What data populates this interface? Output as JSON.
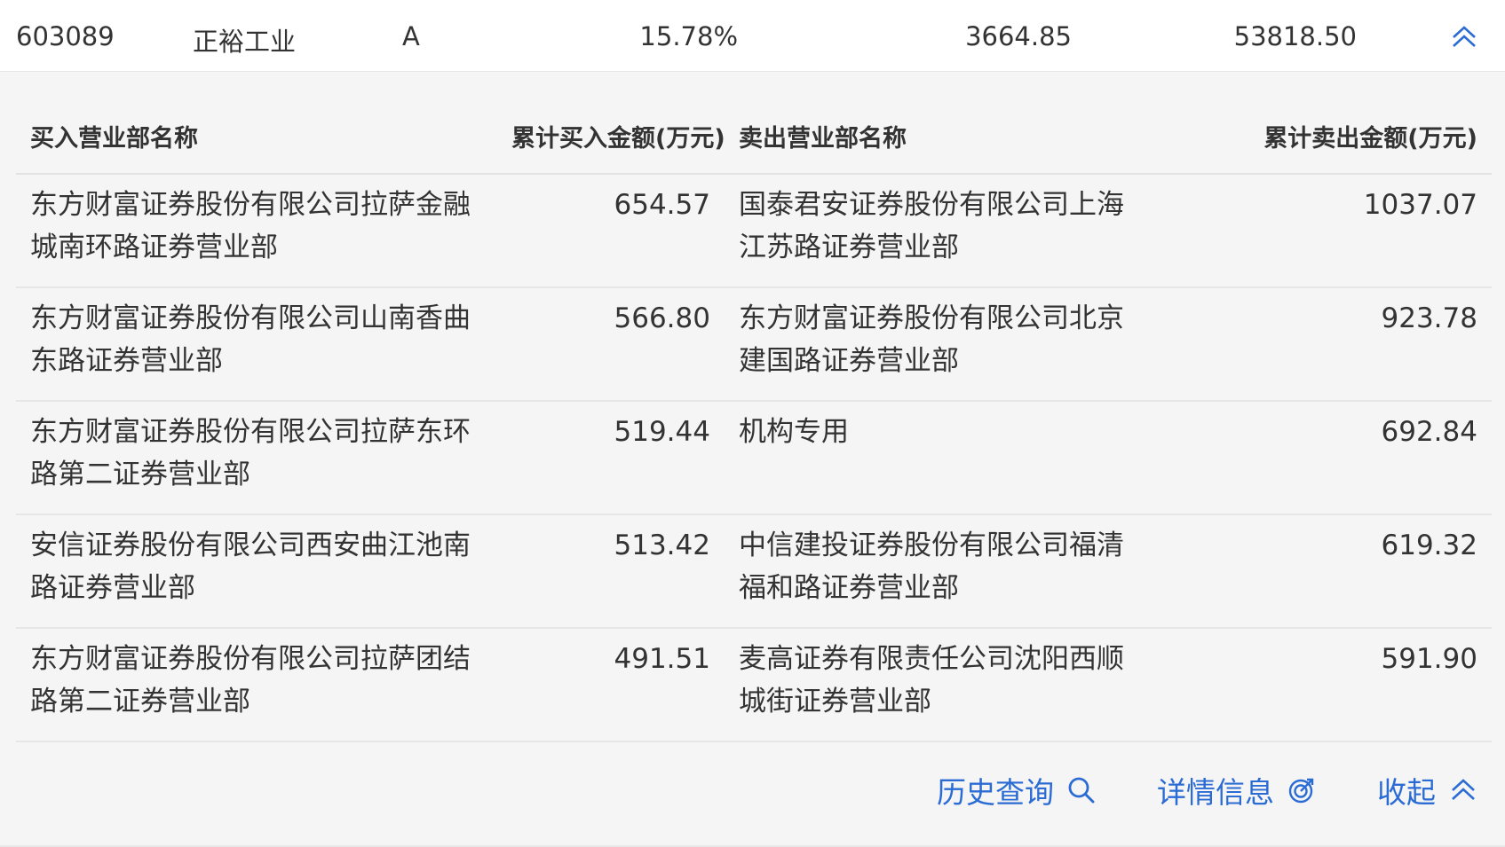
{
  "summary": {
    "code": "603089",
    "name": "正裕工业",
    "type": "A",
    "change_pct": "15.78%",
    "buy_total": "3664.85",
    "sell_total": "53818.50"
  },
  "table": {
    "headers": {
      "buy_name": "买入营业部名称",
      "buy_amount": "累计买入金额(万元)",
      "sell_name": "卖出营业部名称",
      "sell_amount": "累计卖出金额(万元)"
    },
    "rows": [
      {
        "buy_name": "东方财富证券股份有限公司拉萨金融城南环路证券营业部",
        "buy_amount": "654.57",
        "sell_name": "国泰君安证券股份有限公司上海江苏路证券营业部",
        "sell_amount": "1037.07"
      },
      {
        "buy_name": "东方财富证券股份有限公司山南香曲东路证券营业部",
        "buy_amount": "566.80",
        "sell_name": "东方财富证券股份有限公司北京建国路证券营业部",
        "sell_amount": "923.78"
      },
      {
        "buy_name": "东方财富证券股份有限公司拉萨东环路第二证券营业部",
        "buy_amount": "519.44",
        "sell_name": "机构专用",
        "sell_amount": "692.84"
      },
      {
        "buy_name": "安信证券股份有限公司西安曲江池南路证券营业部",
        "buy_amount": "513.42",
        "sell_name": "中信建投证券股份有限公司福清福和路证券营业部",
        "sell_amount": "619.32"
      },
      {
        "buy_name": "东方财富证券股份有限公司拉萨团结路第二证券营业部",
        "buy_amount": "491.51",
        "sell_name": "麦高证券有限责任公司沈阳西顺城街证券营业部",
        "sell_amount": "591.90"
      }
    ]
  },
  "footer": {
    "history_label": "历史查询",
    "details_label": "详情信息",
    "collapse_label": "收起"
  },
  "icons": {
    "toggle": "double-chevron-up-icon",
    "history": "search-icon",
    "details": "target-icon",
    "collapse": "double-chevron-up-icon"
  },
  "colors": {
    "link": "#2b6cd4",
    "panel_bg": "#f5f5f5"
  }
}
